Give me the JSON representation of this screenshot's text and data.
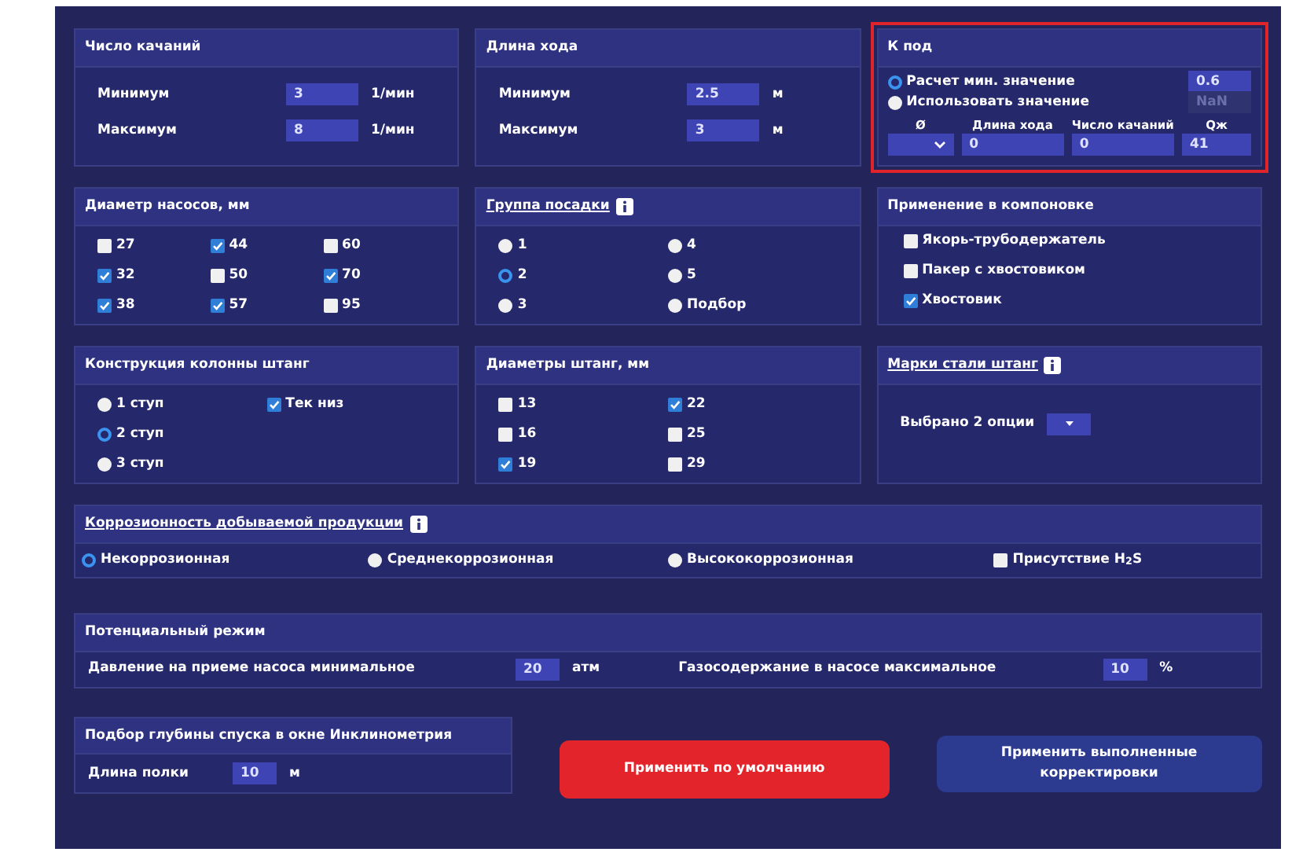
{
  "stroke_count": {
    "title": "Число качаний",
    "rows": [
      {
        "label": "Минимум",
        "value": "3",
        "unit": "1/мин"
      },
      {
        "label": "Максимум",
        "value": "8",
        "unit": "1/мин"
      }
    ]
  },
  "stroke_length": {
    "title": "Длина хода",
    "rows": [
      {
        "label": "Минимум",
        "value": "2.5",
        "unit": "м"
      },
      {
        "label": "Максимум",
        "value": "3",
        "unit": "м"
      }
    ]
  },
  "k_pod": {
    "title": "К под",
    "highlighted": true,
    "options": [
      {
        "label": "Расчет мин. значение",
        "selected": true,
        "value": "0.6"
      },
      {
        "label": "Использовать значение",
        "selected": false,
        "value": "NaN"
      }
    ],
    "columns": [
      {
        "label": "Ø",
        "kind": "select"
      },
      {
        "label": "Длина хода",
        "kind": "input",
        "value": "0"
      },
      {
        "label": "Число качаний",
        "kind": "input",
        "value": "0"
      },
      {
        "label": "Qж",
        "kind": "input",
        "value": "41"
      }
    ]
  },
  "pump_diameters": {
    "title": "Диаметр насосов, мм",
    "items": [
      {
        "label": "27",
        "checked": false
      },
      {
        "label": "44",
        "checked": true
      },
      {
        "label": "60",
        "checked": false
      },
      {
        "label": "32",
        "checked": true
      },
      {
        "label": "50",
        "checked": false
      },
      {
        "label": "70",
        "checked": true
      },
      {
        "label": "38",
        "checked": true
      },
      {
        "label": "57",
        "checked": true
      },
      {
        "label": "95",
        "checked": false
      }
    ]
  },
  "landing_group": {
    "title": "Группа посадки",
    "info": true,
    "items": [
      {
        "label": "1",
        "selected": false
      },
      {
        "label": "4",
        "selected": false
      },
      {
        "label": "2",
        "selected": true
      },
      {
        "label": "5",
        "selected": false
      },
      {
        "label": "3",
        "selected": false
      },
      {
        "label": "Подбор",
        "selected": false
      }
    ]
  },
  "application": {
    "title": "Применение в компоновке",
    "items": [
      {
        "label": "Якорь-трубодержатель",
        "checked": false
      },
      {
        "label": "Пакер с хвостовиком",
        "checked": false
      },
      {
        "label": "Хвостовик",
        "checked": true
      }
    ]
  },
  "rod_column": {
    "title": "Конструкция колонны штанг",
    "items": [
      {
        "kind": "radio",
        "label": "1 ступ",
        "selected": false
      },
      {
        "kind": "checkbox",
        "label": "Тек низ",
        "checked": true
      },
      {
        "kind": "radio",
        "label": "2 ступ",
        "selected": true
      },
      {
        "kind": "empty"
      },
      {
        "kind": "radio",
        "label": "3 ступ",
        "selected": false
      }
    ]
  },
  "rod_diameters": {
    "title": "Диаметры штанг, мм",
    "items": [
      {
        "label": "13",
        "checked": false
      },
      {
        "label": "22",
        "checked": true
      },
      {
        "label": "16",
        "checked": false
      },
      {
        "label": "25",
        "checked": false
      },
      {
        "label": "19",
        "checked": true
      },
      {
        "label": "29",
        "checked": false
      }
    ]
  },
  "steel_grades": {
    "title": "Марки стали штанг",
    "info": true,
    "select": "Выбрано 2 опции"
  },
  "corrosion": {
    "title": "Коррозионность добываемой продукции",
    "info": true,
    "items": [
      {
        "kind": "radio",
        "label": "Некоррозионная",
        "selected": true
      },
      {
        "kind": "radio",
        "label": "Среднекоррозионная",
        "selected": false
      },
      {
        "kind": "radio",
        "label": "Высококоррозионная",
        "selected": false
      },
      {
        "kind": "checkbox",
        "label": "Присутствие H$_{2}$S",
        "checked": false
      }
    ]
  },
  "potential_mode": {
    "title": "Потенциальный режим",
    "fields": [
      {
        "label": "Давление на приеме насоса минимальное",
        "value": "20",
        "unit": "атм"
      },
      {
        "label": "Газосодержание в насосе максимальное",
        "value": "10",
        "unit": "%"
      }
    ]
  },
  "depth_selection": {
    "title": "Подбор глубины спуска в окне Инклинометрия",
    "field": {
      "label": "Длина полки",
      "value": "10",
      "unit": "м"
    }
  },
  "buttons": [
    {
      "label": "Применить по умолчанию",
      "kind": "danger"
    },
    {
      "label": "Применить выполненные корректировки",
      "kind": "primary"
    }
  ]
}
